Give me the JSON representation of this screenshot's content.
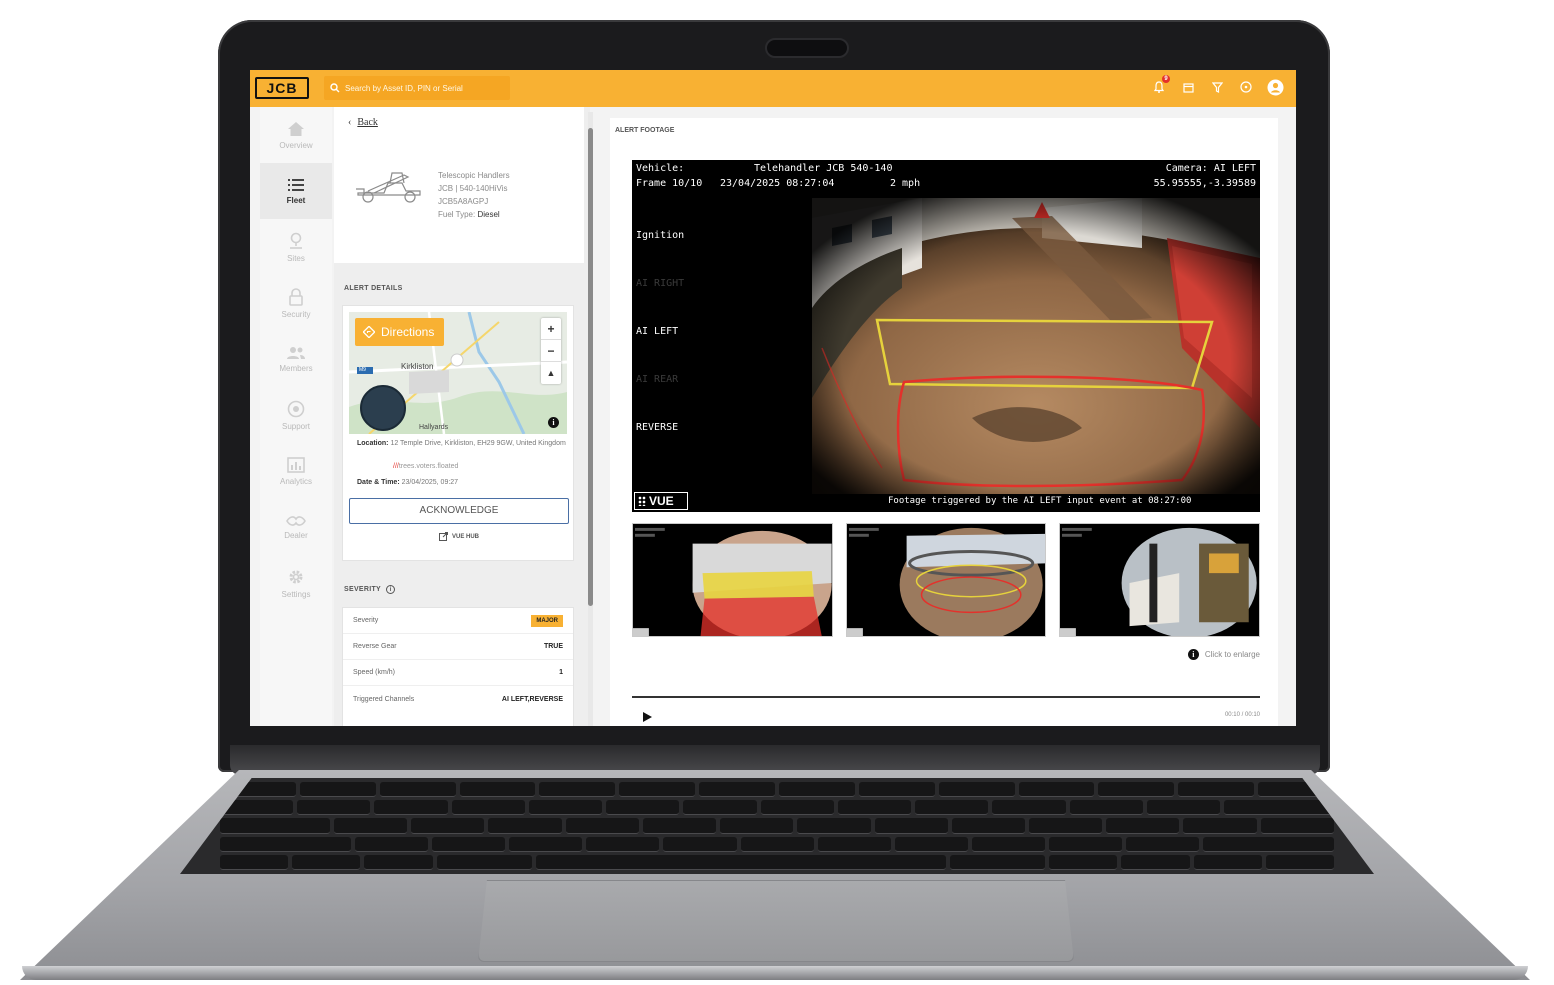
{
  "header": {
    "logo_text": "JCB",
    "search_placeholder": "Search by Asset ID, PIN or Serial",
    "notification_count": "9",
    "accent_color": "#f8b133"
  },
  "sidebar": {
    "items": [
      {
        "label": "Overview",
        "icon": "home-icon"
      },
      {
        "label": "Fleet",
        "icon": "list-icon",
        "active": true
      },
      {
        "label": "Sites",
        "icon": "location-pin-icon"
      },
      {
        "label": "Security",
        "icon": "lock-icon"
      },
      {
        "label": "Members",
        "icon": "members-icon"
      },
      {
        "label": "Support",
        "icon": "support-icon"
      },
      {
        "label": "Analytics",
        "icon": "analytics-icon"
      },
      {
        "label": "Dealer",
        "icon": "dealer-icon"
      },
      {
        "label": "Settings",
        "icon": "gear-icon"
      }
    ]
  },
  "vehicle": {
    "back_label": "Back",
    "type": "Telescopic Handlers",
    "model": "JCB | 540-140HiVis",
    "serial": "JCB5A8AGPJ",
    "fuel_label": "Fuel Type:",
    "fuel_value": "Diesel"
  },
  "alert_details": {
    "title": "ALERT DETAILS",
    "directions_label": "Directions",
    "map_place": "Kirkliston",
    "map_place_2": "Hallyards",
    "map_road": "M9",
    "location_label": "Location:",
    "location_value": "12 Temple Drive, Kirkliston, EH29 9GW, United Kingdom",
    "w3w_value": "trees.voters.floated",
    "datetime_label": "Date & Time:",
    "datetime_value": "23/04/2025, 09:27",
    "acknowledge_label": "ACKNOWLEDGE",
    "vue_hub_label": "VUE HUB"
  },
  "severity": {
    "title": "SEVERITY",
    "rows": [
      {
        "label": "Severity",
        "value": "MAJOR"
      },
      {
        "label": "Reverse Gear",
        "value": "TRUE"
      },
      {
        "label": "Speed (km/h)",
        "value": "1"
      },
      {
        "label": "Triggered Channels",
        "value": "AI LEFT,REVERSE"
      }
    ]
  },
  "footage": {
    "title": "ALERT FOOTAGE",
    "osd_vehicle_label": "Vehicle:",
    "osd_vehicle_value": "Telehandler JCB 540-140",
    "osd_camera": "Camera: AI LEFT",
    "osd_frame": "Frame 10/10",
    "osd_datetime": "23/04/2025 08:27:04",
    "osd_speed": "2 mph",
    "osd_coords": "55.95555,-3.39589",
    "channels": [
      {
        "label": "Ignition",
        "active": true
      },
      {
        "label": "AI RIGHT",
        "active": false
      },
      {
        "label": "AI LEFT",
        "active": true
      },
      {
        "label": "AI REAR",
        "active": false
      },
      {
        "label": "REVERSE",
        "active": true
      }
    ],
    "vue_logo": "VUE",
    "trigger_text": "Footage triggered by the AI LEFT input event at 08:27:00",
    "enlarge_label": "Click to enlarge",
    "time_label": "00:10 / 00:10"
  }
}
